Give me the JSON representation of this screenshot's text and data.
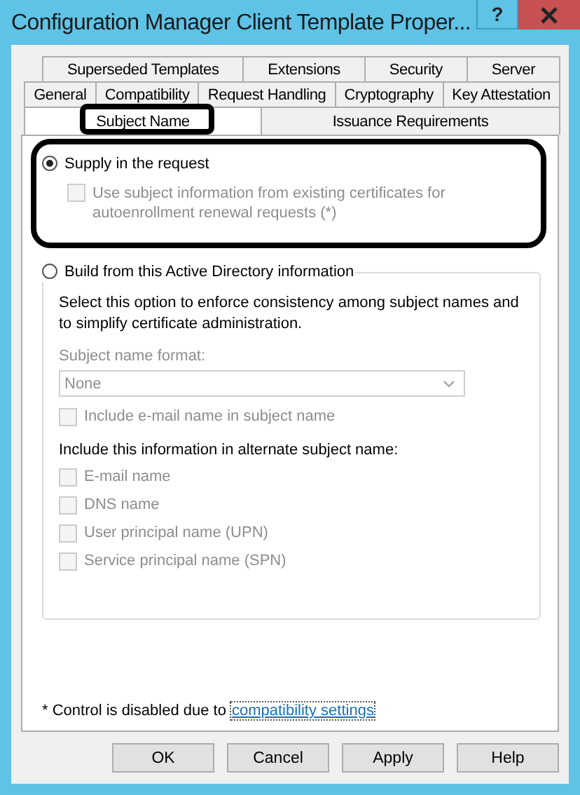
{
  "window": {
    "title": "Configuration Manager Client Template Proper...",
    "help": "?"
  },
  "tab_rows": [
    [
      {
        "label": "Superseded Templates",
        "selected": false
      },
      {
        "label": "Extensions",
        "selected": false
      },
      {
        "label": "Security",
        "selected": false
      },
      {
        "label": "Server",
        "selected": false
      }
    ],
    [
      {
        "label": "General",
        "selected": false
      },
      {
        "label": "Compatibility",
        "selected": false
      },
      {
        "label": "Request Handling",
        "selected": false
      },
      {
        "label": "Cryptography",
        "selected": false
      },
      {
        "label": "Key Attestation",
        "selected": false
      }
    ],
    [
      {
        "label": "Subject Name",
        "selected": true
      },
      {
        "label": "Issuance Requirements",
        "selected": false
      }
    ]
  ],
  "supply_option": {
    "label": "Supply in the request",
    "selected": true
  },
  "autoenrollment_checkbox": {
    "label": "Use subject information from existing certificates for autoenrollment renewal requests (*)",
    "checked": false,
    "disabled": true
  },
  "build_option": {
    "label": "Build from this Active Directory information",
    "selected": false
  },
  "ad_group": {
    "description": "Select this option to enforce consistency among subject names and to simplify certificate administration.",
    "format_label": "Subject name format:",
    "format_value": "None",
    "disabled": true,
    "include_email": {
      "label": "Include e-mail name in subject name",
      "checked": false,
      "disabled": true
    },
    "alt_heading": "Include this information in alternate subject name:",
    "alt_options": [
      {
        "label": "E-mail name",
        "checked": false,
        "disabled": true
      },
      {
        "label": "DNS name",
        "checked": false,
        "disabled": true
      },
      {
        "label": "User principal name (UPN)",
        "checked": false,
        "disabled": true
      },
      {
        "label": "Service principal name (SPN)",
        "checked": false,
        "disabled": true
      }
    ]
  },
  "footnote": {
    "text": "* Control is disabled due to",
    "link": "compatibility settings"
  },
  "buttons": [
    {
      "label": "OK"
    },
    {
      "label": "Cancel"
    },
    {
      "label": "Apply"
    },
    {
      "label": "Help"
    }
  ]
}
